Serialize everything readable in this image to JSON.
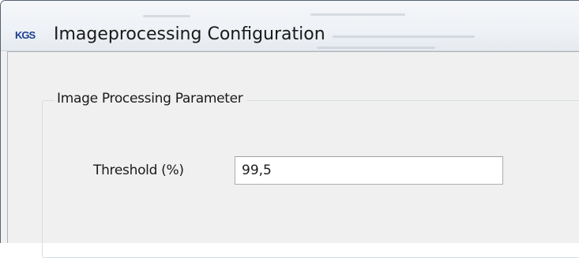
{
  "window": {
    "title": "Imageprocessing Configuration",
    "app_icon_text": "KGS"
  },
  "group": {
    "title": "Image Processing Parameter"
  },
  "fields": {
    "threshold": {
      "label": "Threshold (%)",
      "value": "99,5"
    }
  }
}
